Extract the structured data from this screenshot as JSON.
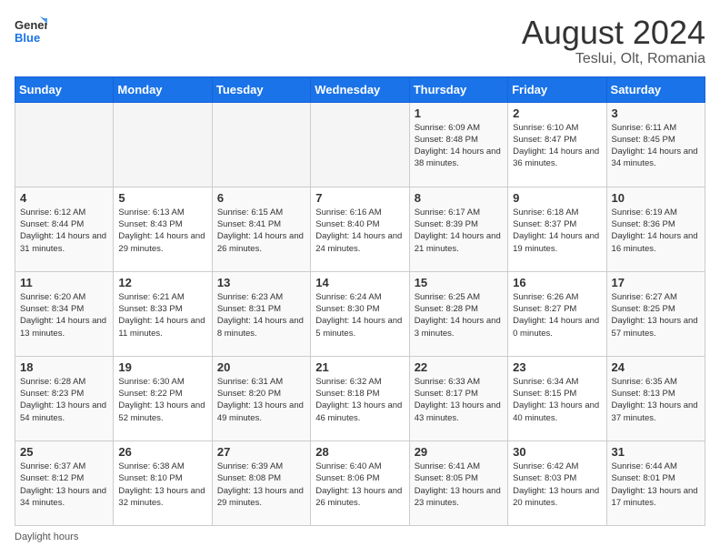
{
  "header": {
    "logo_line1": "General",
    "logo_line2": "Blue",
    "month_year": "August 2024",
    "location": "Teslui, Olt, Romania"
  },
  "days_of_week": [
    "Sunday",
    "Monday",
    "Tuesday",
    "Wednesday",
    "Thursday",
    "Friday",
    "Saturday"
  ],
  "weeks": [
    [
      {
        "day": "",
        "info": ""
      },
      {
        "day": "",
        "info": ""
      },
      {
        "day": "",
        "info": ""
      },
      {
        "day": "",
        "info": ""
      },
      {
        "day": "1",
        "info": "Sunrise: 6:09 AM\nSunset: 8:48 PM\nDaylight: 14 hours and 38 minutes."
      },
      {
        "day": "2",
        "info": "Sunrise: 6:10 AM\nSunset: 8:47 PM\nDaylight: 14 hours and 36 minutes."
      },
      {
        "day": "3",
        "info": "Sunrise: 6:11 AM\nSunset: 8:45 PM\nDaylight: 14 hours and 34 minutes."
      }
    ],
    [
      {
        "day": "4",
        "info": "Sunrise: 6:12 AM\nSunset: 8:44 PM\nDaylight: 14 hours and 31 minutes."
      },
      {
        "day": "5",
        "info": "Sunrise: 6:13 AM\nSunset: 8:43 PM\nDaylight: 14 hours and 29 minutes."
      },
      {
        "day": "6",
        "info": "Sunrise: 6:15 AM\nSunset: 8:41 PM\nDaylight: 14 hours and 26 minutes."
      },
      {
        "day": "7",
        "info": "Sunrise: 6:16 AM\nSunset: 8:40 PM\nDaylight: 14 hours and 24 minutes."
      },
      {
        "day": "8",
        "info": "Sunrise: 6:17 AM\nSunset: 8:39 PM\nDaylight: 14 hours and 21 minutes."
      },
      {
        "day": "9",
        "info": "Sunrise: 6:18 AM\nSunset: 8:37 PM\nDaylight: 14 hours and 19 minutes."
      },
      {
        "day": "10",
        "info": "Sunrise: 6:19 AM\nSunset: 8:36 PM\nDaylight: 14 hours and 16 minutes."
      }
    ],
    [
      {
        "day": "11",
        "info": "Sunrise: 6:20 AM\nSunset: 8:34 PM\nDaylight: 14 hours and 13 minutes."
      },
      {
        "day": "12",
        "info": "Sunrise: 6:21 AM\nSunset: 8:33 PM\nDaylight: 14 hours and 11 minutes."
      },
      {
        "day": "13",
        "info": "Sunrise: 6:23 AM\nSunset: 8:31 PM\nDaylight: 14 hours and 8 minutes."
      },
      {
        "day": "14",
        "info": "Sunrise: 6:24 AM\nSunset: 8:30 PM\nDaylight: 14 hours and 5 minutes."
      },
      {
        "day": "15",
        "info": "Sunrise: 6:25 AM\nSunset: 8:28 PM\nDaylight: 14 hours and 3 minutes."
      },
      {
        "day": "16",
        "info": "Sunrise: 6:26 AM\nSunset: 8:27 PM\nDaylight: 14 hours and 0 minutes."
      },
      {
        "day": "17",
        "info": "Sunrise: 6:27 AM\nSunset: 8:25 PM\nDaylight: 13 hours and 57 minutes."
      }
    ],
    [
      {
        "day": "18",
        "info": "Sunrise: 6:28 AM\nSunset: 8:23 PM\nDaylight: 13 hours and 54 minutes."
      },
      {
        "day": "19",
        "info": "Sunrise: 6:30 AM\nSunset: 8:22 PM\nDaylight: 13 hours and 52 minutes."
      },
      {
        "day": "20",
        "info": "Sunrise: 6:31 AM\nSunset: 8:20 PM\nDaylight: 13 hours and 49 minutes."
      },
      {
        "day": "21",
        "info": "Sunrise: 6:32 AM\nSunset: 8:18 PM\nDaylight: 13 hours and 46 minutes."
      },
      {
        "day": "22",
        "info": "Sunrise: 6:33 AM\nSunset: 8:17 PM\nDaylight: 13 hours and 43 minutes."
      },
      {
        "day": "23",
        "info": "Sunrise: 6:34 AM\nSunset: 8:15 PM\nDaylight: 13 hours and 40 minutes."
      },
      {
        "day": "24",
        "info": "Sunrise: 6:35 AM\nSunset: 8:13 PM\nDaylight: 13 hours and 37 minutes."
      }
    ],
    [
      {
        "day": "25",
        "info": "Sunrise: 6:37 AM\nSunset: 8:12 PM\nDaylight: 13 hours and 34 minutes."
      },
      {
        "day": "26",
        "info": "Sunrise: 6:38 AM\nSunset: 8:10 PM\nDaylight: 13 hours and 32 minutes."
      },
      {
        "day": "27",
        "info": "Sunrise: 6:39 AM\nSunset: 8:08 PM\nDaylight: 13 hours and 29 minutes."
      },
      {
        "day": "28",
        "info": "Sunrise: 6:40 AM\nSunset: 8:06 PM\nDaylight: 13 hours and 26 minutes."
      },
      {
        "day": "29",
        "info": "Sunrise: 6:41 AM\nSunset: 8:05 PM\nDaylight: 13 hours and 23 minutes."
      },
      {
        "day": "30",
        "info": "Sunrise: 6:42 AM\nSunset: 8:03 PM\nDaylight: 13 hours and 20 minutes."
      },
      {
        "day": "31",
        "info": "Sunrise: 6:44 AM\nSunset: 8:01 PM\nDaylight: 13 hours and 17 minutes."
      }
    ]
  ],
  "footer": {
    "daylight_label": "Daylight hours"
  }
}
